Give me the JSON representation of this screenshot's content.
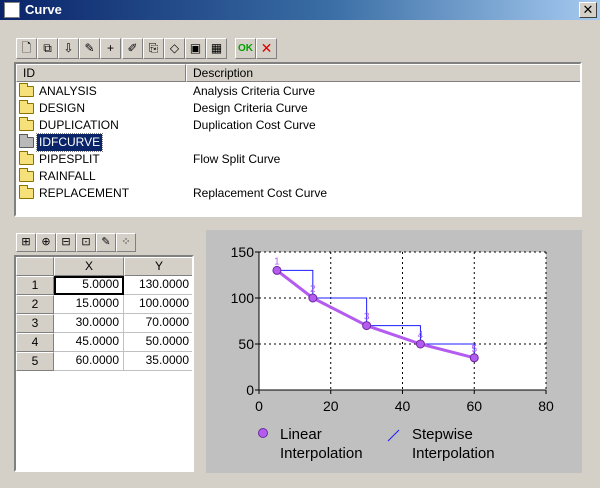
{
  "window": {
    "title": "Curve",
    "close_glyph": "✕"
  },
  "toolbar": {
    "buttons": [
      {
        "name": "new-curve-button",
        "icon": "new-document-icon",
        "glyph": "🗋"
      },
      {
        "name": "copy-curve-button",
        "icon": "copy-icon",
        "glyph": "⧉"
      },
      {
        "name": "import-curve-button",
        "icon": "import-icon",
        "glyph": "⇩"
      },
      {
        "name": "rename-curve-button",
        "icon": "rename-icon",
        "glyph": "✎"
      },
      {
        "name": "add-curve-button",
        "icon": "add-icon",
        "glyph": "+"
      },
      {
        "name": "edit-curve-button",
        "icon": "pencil-icon",
        "glyph": "✐"
      },
      {
        "name": "open-curve-button",
        "icon": "open-icon",
        "glyph": "⎘"
      },
      {
        "name": "erase-curve-button",
        "icon": "eraser-icon",
        "glyph": "◇"
      },
      {
        "name": "save-curve-button",
        "icon": "save-icon",
        "glyph": "▣"
      },
      {
        "name": "save-all-button",
        "icon": "save-all-icon",
        "glyph": "▦"
      },
      {
        "name": "ok-button",
        "icon": "ok-icon",
        "glyph": "OK"
      },
      {
        "name": "cancel-button",
        "icon": "close-icon",
        "glyph": "✕"
      }
    ]
  },
  "curve_list": {
    "columns": [
      "ID",
      "Description"
    ],
    "rows": [
      {
        "id": "ANALYSIS",
        "description": "Analysis Criteria Curve",
        "selected": false
      },
      {
        "id": "DESIGN",
        "description": "Design Criteria Curve",
        "selected": false
      },
      {
        "id": "DUPLICATION",
        "description": "Duplication Cost Curve",
        "selected": false
      },
      {
        "id": "IDFCURVE",
        "description": "",
        "selected": true
      },
      {
        "id": "PIPESPLIT",
        "description": "Flow Split Curve",
        "selected": false
      },
      {
        "id": "RAINFALL",
        "description": "",
        "selected": false
      },
      {
        "id": "REPLACEMENT",
        "description": "Replacement Cost Curve",
        "selected": false
      }
    ]
  },
  "table_toolbar": {
    "buttons": [
      {
        "name": "insert-row-button",
        "icon": "insert-row-icon",
        "glyph": "⊞"
      },
      {
        "name": "append-row-button",
        "icon": "append-row-icon",
        "glyph": "⊕"
      },
      {
        "name": "delete-row-button",
        "icon": "delete-row-icon",
        "glyph": "⊟"
      },
      {
        "name": "import-table-button",
        "icon": "import-table-icon",
        "glyph": "⊡"
      },
      {
        "name": "edit-table-button",
        "icon": "edit-table-icon",
        "glyph": "✎"
      },
      {
        "name": "format-table-button",
        "icon": "format-icon",
        "glyph": "⁘"
      }
    ]
  },
  "data_table": {
    "columns": [
      "X",
      "Y"
    ],
    "rows": [
      {
        "n": "1",
        "x": "5.0000",
        "y": "130.0000"
      },
      {
        "n": "2",
        "x": "15.0000",
        "y": "100.0000"
      },
      {
        "n": "3",
        "x": "30.0000",
        "y": "70.0000"
      },
      {
        "n": "4",
        "x": "45.0000",
        "y": "50.0000"
      },
      {
        "n": "5",
        "x": "60.0000",
        "y": "35.0000"
      }
    ]
  },
  "chart_data": {
    "type": "line",
    "x": [
      5,
      15,
      30,
      45,
      60
    ],
    "series": [
      {
        "name": "Linear Interpolation",
        "values": [
          130,
          100,
          70,
          50,
          35
        ],
        "color": "#b45cf0"
      },
      {
        "name": "Stepwise Interpolation",
        "values": [
          130,
          100,
          70,
          50,
          35
        ],
        "color": "#1c1cff"
      }
    ],
    "point_labels": [
      "1",
      "2",
      "3",
      "4",
      "5"
    ],
    "xlim": [
      0,
      80
    ],
    "ylim": [
      0,
      150
    ],
    "xticks": [
      0,
      20,
      40,
      60,
      80
    ],
    "yticks": [
      0,
      50,
      100,
      150
    ],
    "grid": true,
    "legend": [
      {
        "line1": "Linear",
        "line2": "Interpolation"
      },
      {
        "line1": "Stepwise",
        "line2": "Interpolation"
      }
    ],
    "legend_position": "bottom"
  },
  "colors": {
    "title_bar": "#0a246a",
    "selection": "#0a246a",
    "chart_background": "#c0c0c0"
  }
}
